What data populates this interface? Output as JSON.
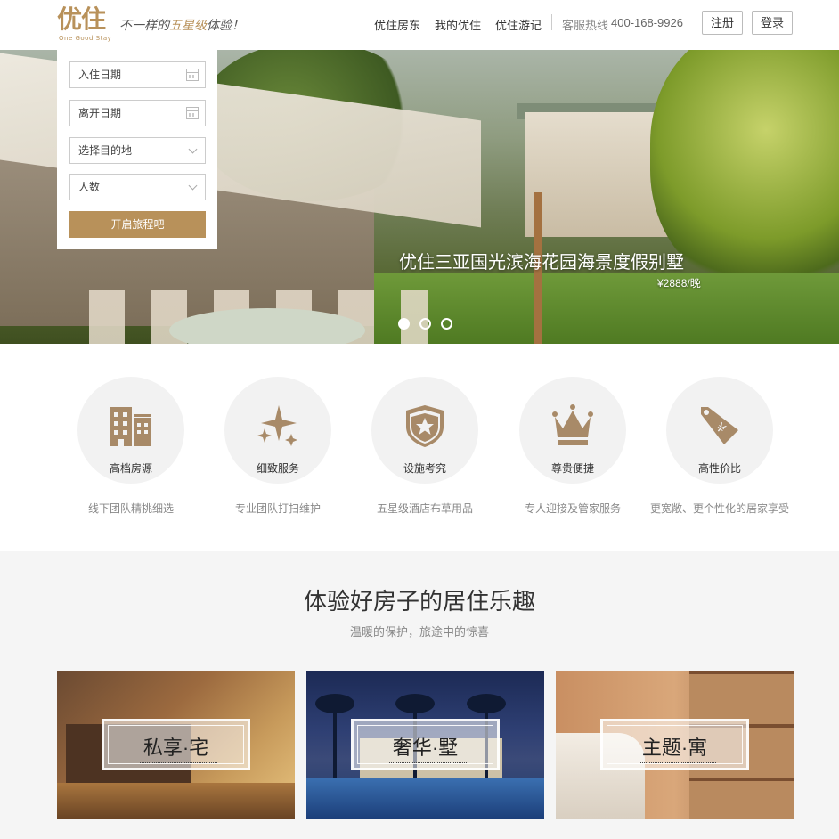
{
  "header": {
    "logo_text": "优住",
    "logo_subtext": "One Good Stay",
    "slogan_prefix": "不一样的",
    "slogan_highlight": "五星级",
    "slogan_suffix": "体验！",
    "nav": [
      "优住房东",
      "我的优住",
      "优住游记"
    ],
    "hotline_label": "客服热线",
    "hotline_number": "400-168-9926",
    "register_label": "注册",
    "login_label": "登录"
  },
  "search": {
    "checkin_placeholder": "入住日期",
    "checkout_placeholder": "离开日期",
    "destination_placeholder": "选择目的地",
    "guests_placeholder": "人数",
    "submit_label": "开启旅程吧"
  },
  "hero": {
    "title": "优住三亚国光滨海花园海景度假别墅",
    "price": "¥2888/晚",
    "slide_count": 3,
    "active_slide": 1
  },
  "features": [
    {
      "label": "高档房源",
      "desc": "线下团队精挑细选",
      "icon": "building-icon"
    },
    {
      "label": "细致服务",
      "desc": "专业团队打扫维护",
      "icon": "sparkle-icon"
    },
    {
      "label": "设施考究",
      "desc": "五星级酒店布草用品",
      "icon": "shield-star-icon"
    },
    {
      "label": "尊贵便捷",
      "desc": "专人迎接及管家服务",
      "icon": "crown-icon"
    },
    {
      "label": "高性价比",
      "desc": "更宽敞、更个性化的居家享受",
      "icon": "price-tag-icon"
    }
  ],
  "experience": {
    "title": "体验好房子的居住乐趣",
    "subtitle": "温暖的保护，旅途中的惊喜",
    "cards": [
      {
        "label": "私享·宅"
      },
      {
        "label": "奢华·墅"
      },
      {
        "label": "主题·寓"
      }
    ]
  },
  "colors": {
    "accent": "#b8915a",
    "feature_icon": "#a88a68",
    "feature_bg": "#f2f2f2",
    "section_bg": "#f5f5f5"
  }
}
